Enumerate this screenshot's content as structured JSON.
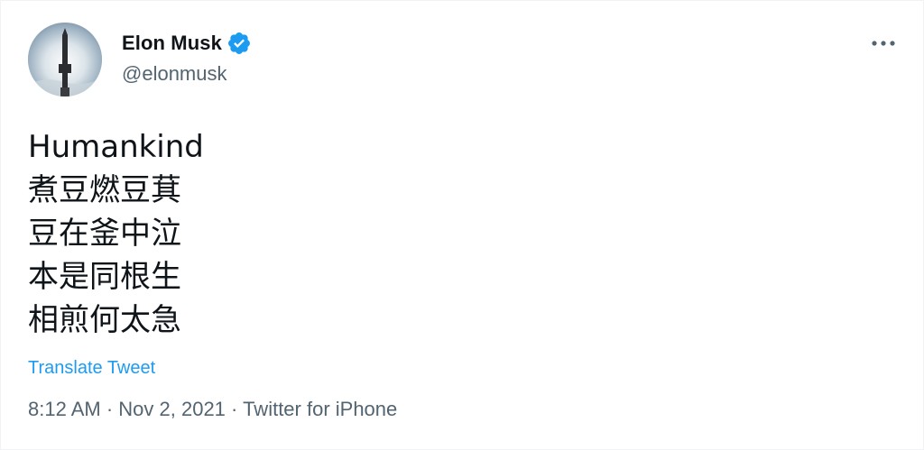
{
  "author": {
    "display_name": "Elon Musk",
    "handle": "@elonmusk",
    "verified": true,
    "verified_color": "#1d9bf0"
  },
  "tweet": {
    "lines": [
      "Humankind",
      "煮豆燃豆萁",
      "豆在釜中泣",
      "本是同根生",
      "相煎何太急"
    ],
    "translate_label": "Translate Tweet"
  },
  "meta": {
    "time": "8:12 AM",
    "separator": " · ",
    "date": "Nov 2, 2021",
    "source": "Twitter for iPhone"
  },
  "colors": {
    "text_primary": "#0f1419",
    "text_secondary": "#536471",
    "link": "#1d9bf0"
  },
  "icons": {
    "more": "more-horizontal-icon",
    "verified": "verified-badge-icon"
  }
}
